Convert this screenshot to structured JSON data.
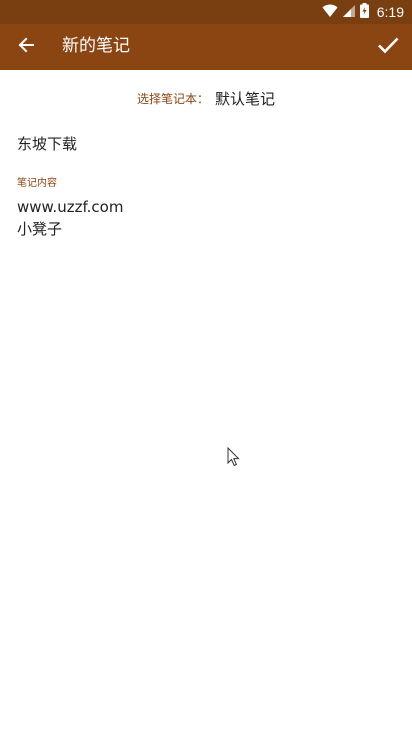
{
  "status_bar": {
    "time": "6:19",
    "icons": [
      "wifi-icon",
      "signal-icon",
      "battery-icon"
    ]
  },
  "app_bar": {
    "title": "新的笔记",
    "back_icon": "arrow-back-icon",
    "confirm_icon": "check-icon"
  },
  "notebook": {
    "label": "选择笔记本：",
    "selected": "默认笔记"
  },
  "note": {
    "title_value": "东坡下载",
    "content_label": "笔记内容",
    "content_lines": [
      "www.uzzf.com",
      "小凳子"
    ]
  },
  "colors": {
    "status_bar": "#7a3f10",
    "app_bar": "#8b4513",
    "accent_text": "#8b4513",
    "body_text": "#222222",
    "background": "#ffffff"
  }
}
